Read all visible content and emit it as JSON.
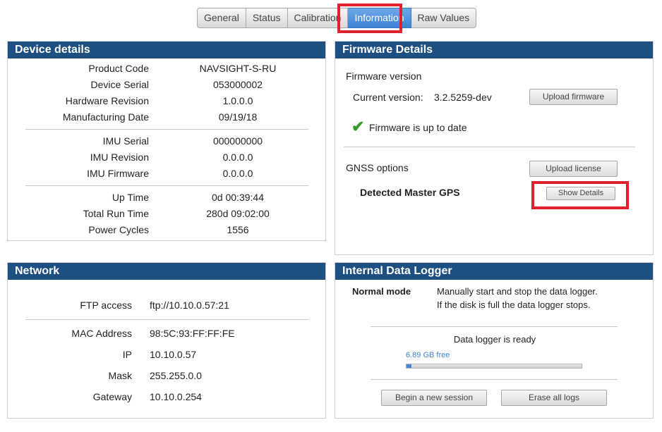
{
  "tabs": [
    "General",
    "Status",
    "Calibration",
    "Information",
    "Raw Values"
  ],
  "active_tab": "Information",
  "device": {
    "title": "Device details",
    "rows": [
      {
        "label": "Product Code",
        "value": "NAVSIGHT-S-RU"
      },
      {
        "label": "Device Serial",
        "value": "053000002"
      },
      {
        "label": "Hardware Revision",
        "value": "1.0.0.0"
      },
      {
        "label": "Manufacturing Date",
        "value": "09/19/18"
      },
      {
        "label": "IMU Serial",
        "value": "000000000"
      },
      {
        "label": "IMU Revision",
        "value": "0.0.0.0"
      },
      {
        "label": "IMU Firmware",
        "value": "0.0.0.0"
      },
      {
        "label": "Up Time",
        "value": "0d 00:39:44"
      },
      {
        "label": "Total Run Time",
        "value": "280d 09:02:00"
      },
      {
        "label": "Power Cycles",
        "value": "1556"
      }
    ]
  },
  "network": {
    "title": "Network",
    "rows": [
      {
        "label": "FTP access",
        "value": "ftp://10.10.0.57:21"
      },
      {
        "label": "MAC Address",
        "value": "98:5C:93:FF:FF:FE"
      },
      {
        "label": "IP",
        "value": "10.10.0.57"
      },
      {
        "label": "Mask",
        "value": "255.255.0.0"
      },
      {
        "label": "Gateway",
        "value": "10.10.0.254"
      }
    ]
  },
  "firmware": {
    "title": "Firmware Details",
    "version_heading": "Firmware version",
    "current_label": "Current version:",
    "current_value": "3.2.5259-dev",
    "upload_firmware": "Upload firmware",
    "status": "Firmware is up to date",
    "gnss_heading": "GNSS options",
    "upload_license": "Upload license",
    "detected_gps": "Detected Master GPS",
    "show_details": "Show Details",
    "check_color": "#3a9a2a"
  },
  "logger": {
    "title": "Internal Data Logger",
    "mode_label": "Normal mode",
    "mode_desc_1": "Manually start and stop the data logger.",
    "mode_desc_2": "If the disk is full the data logger stops.",
    "status": "Data logger is ready",
    "free_space": "6.89 GB free",
    "used_fraction": 0.03,
    "begin_session": "Begin a new session",
    "erase_logs": "Erase all logs"
  },
  "colors": {
    "header_bg": "#1d5080",
    "highlight": "#e0202a",
    "tab_active": "#3c82d6"
  }
}
